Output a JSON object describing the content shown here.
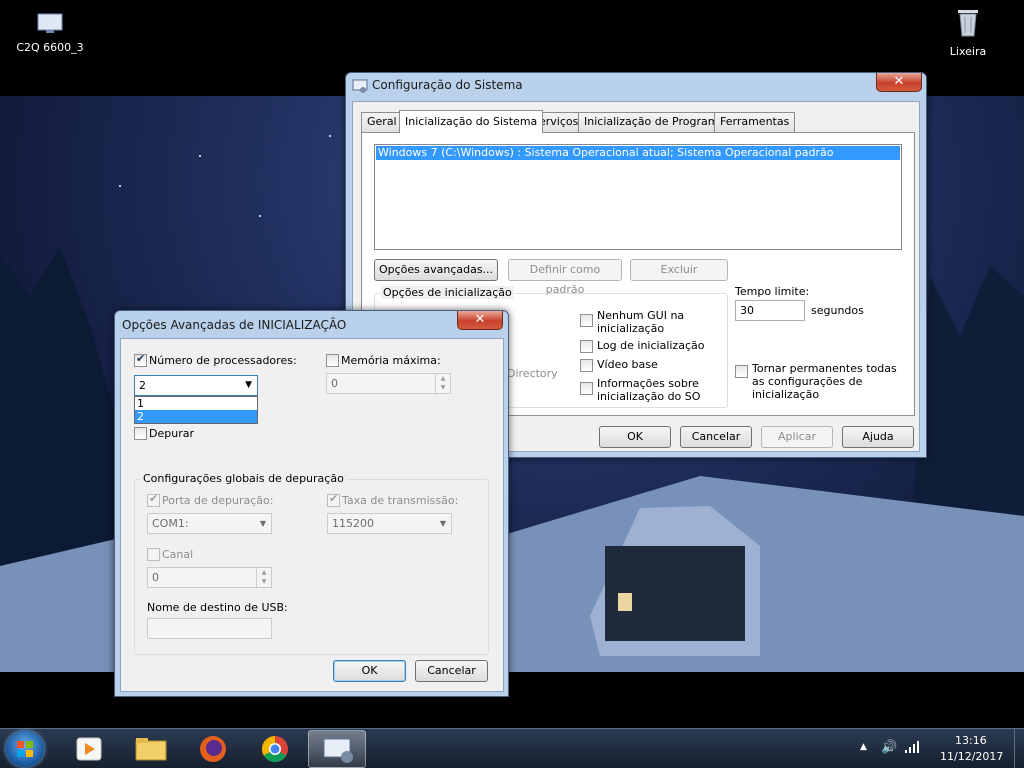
{
  "desktop": {
    "icons": [
      {
        "label": "C2Q 6600_3",
        "icon": "computer-icon"
      },
      {
        "label": "Lixeira",
        "icon": "recycle-bin-icon"
      }
    ]
  },
  "msconfig": {
    "title": "Configuração do Sistema",
    "close": "✕",
    "tabs": [
      "Geral",
      "Inicialização do Sistema",
      "Serviços",
      "Inicialização de Programas",
      "Ferramentas"
    ],
    "active_tab": "Inicialização do Sistema",
    "boot_entries": [
      "Windows 7 (C:\\Windows) : Sistema Operacional atual; Sistema Operacional padrão"
    ],
    "buttons": {
      "advanced": "Opções avançadas...",
      "set_default": "Definir como padrão",
      "delete": "Excluir"
    },
    "boot_options_title": "Opções de inicialização",
    "boot_options_partial": "Directory",
    "right_options": [
      "Nenhum GUI na\ninicialização",
      "Log de inicialização",
      "Vídeo base",
      "Informações sobre\ninicialização do SO"
    ],
    "timeout_label": "Tempo limite:",
    "timeout_value": "30",
    "timeout_unit": "segundos",
    "permanent_label": "Tornar permanentes todas\nas configurações de\ninicialização",
    "footer": {
      "ok": "OK",
      "cancel": "Cancelar",
      "apply": "Aplicar",
      "help": "Ajuda"
    }
  },
  "advanced": {
    "title": "Opções Avançadas de INICIALIZAÇÃO",
    "close": "✕",
    "num_processors_label": "Número de processadores:",
    "num_processors_checked": true,
    "num_processors_value": "2",
    "num_processors_options": [
      "1",
      "2"
    ],
    "max_memory_label": "Memória máxima:",
    "max_memory_value": "0",
    "debug_label": "Depurar",
    "debug_group_title": "Configurações globais de depuração",
    "debug_port_label": "Porta de depuração:",
    "debug_port_value": "COM1:",
    "baud_rate_label": "Taxa de transmissão:",
    "baud_rate_value": "115200",
    "channel_label": "Canal",
    "channel_value": "0",
    "usb_label": "Nome de destino de USB:",
    "usb_value": "",
    "ok": "OK",
    "cancel": "Cancelar"
  },
  "taskbar": {
    "apps": [
      "media-player-icon",
      "file-explorer-icon",
      "firefox-icon",
      "chrome-icon",
      "msconfig-icon"
    ],
    "clock_time": "13:16",
    "clock_date": "11/12/2017"
  },
  "colors": {
    "selection": "#3399ff",
    "taskbar": "#1c2a3c",
    "close_red": "#c7402b"
  }
}
